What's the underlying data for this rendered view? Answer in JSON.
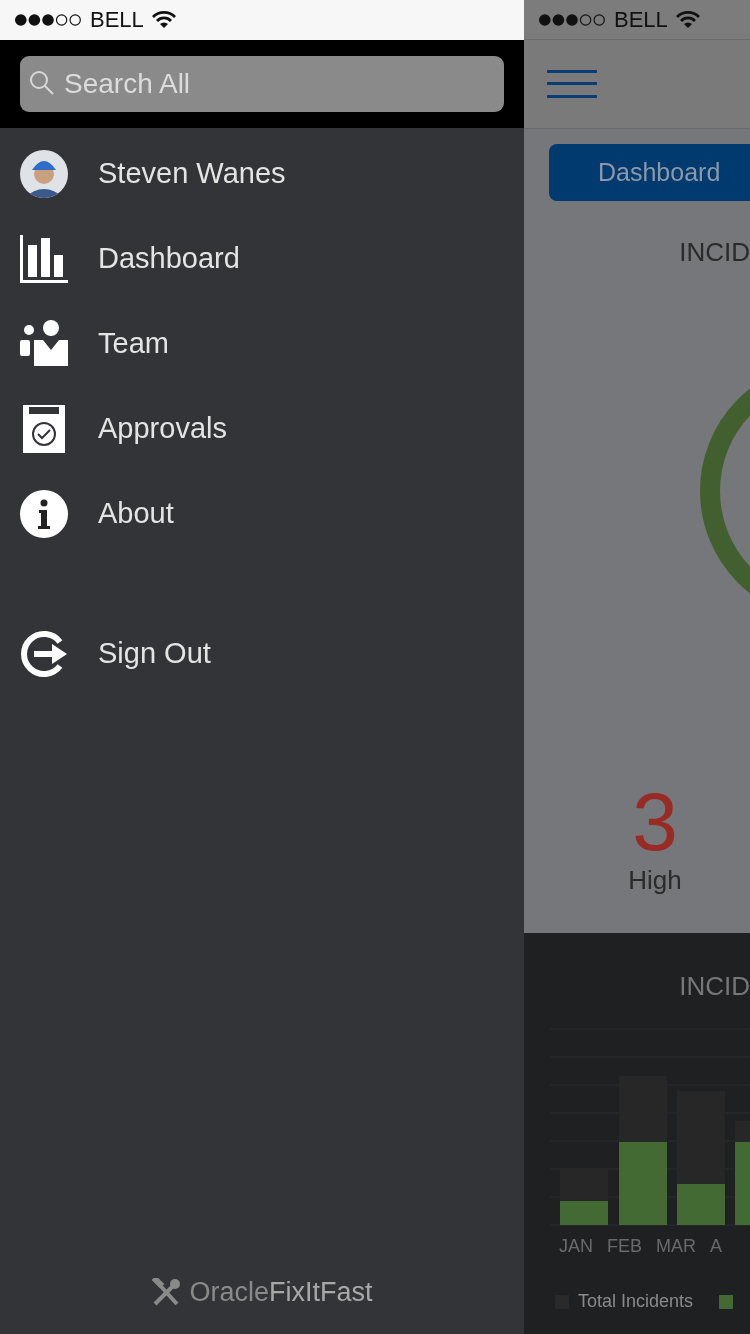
{
  "status_bars": [
    {
      "carrier": "BELL"
    },
    {
      "carrier": "BELL"
    }
  ],
  "search": {
    "placeholder": "Search All"
  },
  "menu": [
    {
      "label": "Steven Wanes",
      "kind": "profile"
    },
    {
      "label": "Dashboard",
      "kind": "dashboard"
    },
    {
      "label": "Team",
      "kind": "team"
    },
    {
      "label": "Approvals",
      "kind": "approvals"
    },
    {
      "label": "About",
      "kind": "about"
    },
    {
      "label": "Sign Out",
      "kind": "signout"
    }
  ],
  "logo": {
    "prefix": "Oracle",
    "name": "FixItFast"
  },
  "background_screen": {
    "tab": {
      "label": "Dashboard",
      "selected": true
    },
    "title": "INCID",
    "count": "3",
    "count_label": "High",
    "chart_section": {
      "title": "INCID",
      "months": [
        "JAN",
        "FEB",
        "MAR",
        "A"
      ],
      "legend": [
        {
          "label": "Total Incidents",
          "color": "#2a2a2a"
        },
        {
          "color": "#446a33"
        }
      ]
    }
  }
}
